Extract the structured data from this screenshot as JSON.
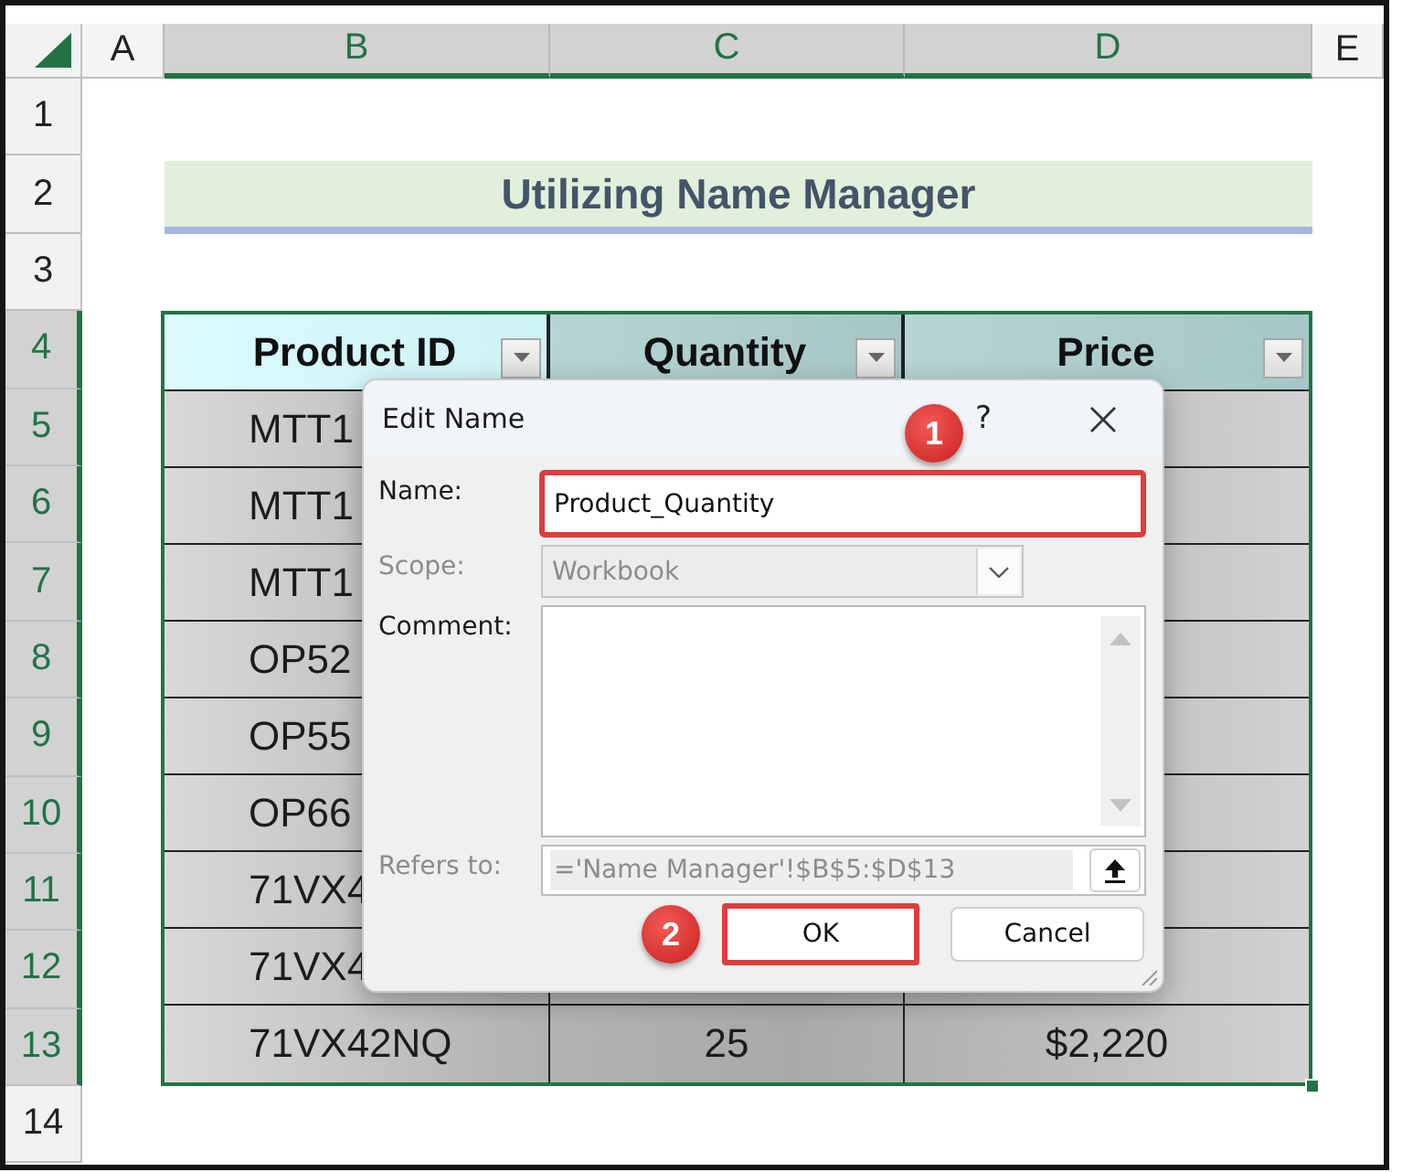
{
  "sheet": {
    "columns": [
      {
        "label": "A",
        "selected": false
      },
      {
        "label": "B",
        "selected": true
      },
      {
        "label": "C",
        "selected": true
      },
      {
        "label": "D",
        "selected": true
      },
      {
        "label": "E",
        "selected": false
      }
    ],
    "rows": [
      {
        "label": "1",
        "selected": false
      },
      {
        "label": "2",
        "selected": false
      },
      {
        "label": "3",
        "selected": false
      },
      {
        "label": "4",
        "selected": true
      },
      {
        "label": "5",
        "selected": true
      },
      {
        "label": "6",
        "selected": true
      },
      {
        "label": "7",
        "selected": true
      },
      {
        "label": "8",
        "selected": true
      },
      {
        "label": "9",
        "selected": true
      },
      {
        "label": "10",
        "selected": true
      },
      {
        "label": "11",
        "selected": true
      },
      {
        "label": "12",
        "selected": true
      },
      {
        "label": "13",
        "selected": true
      },
      {
        "label": "14",
        "selected": false
      }
    ],
    "title": "Utilizing Name Manager",
    "table": {
      "columns": [
        {
          "label": "Product ID"
        },
        {
          "label": "Quantity"
        },
        {
          "label": "Price"
        }
      ],
      "rows": [
        {
          "product_id": "MTT1"
        },
        {
          "product_id": "MTT1"
        },
        {
          "product_id": "MTT1"
        },
        {
          "product_id": "OP52"
        },
        {
          "product_id": "OP55"
        },
        {
          "product_id": "OP66"
        },
        {
          "product_id": "71VX4"
        },
        {
          "product_id": "71VX4"
        },
        {
          "product_id": "71VX42NQ",
          "quantity": "25",
          "price": "$2,220"
        }
      ]
    }
  },
  "dialog": {
    "title": "Edit Name",
    "help_label": "?",
    "fields": [
      {
        "kind": "text",
        "label": "Name:",
        "value": "Product_Quantity",
        "disabled": false,
        "highlighted": true,
        "callout": "1"
      },
      {
        "kind": "select",
        "label": "Scope:",
        "value": "Workbook",
        "disabled": true,
        "highlighted": false
      },
      {
        "kind": "textarea",
        "label": "Comment:",
        "disabled": false,
        "highlighted": false
      },
      {
        "kind": "reference",
        "label": "Refers to:",
        "value": "='Name Manager'!$B$5:$D$13",
        "disabled": true,
        "highlighted": false
      }
    ],
    "buttons": [
      {
        "label": "OK",
        "highlighted": true,
        "callout": "2"
      },
      {
        "label": "Cancel",
        "highlighted": false
      }
    ]
  }
}
